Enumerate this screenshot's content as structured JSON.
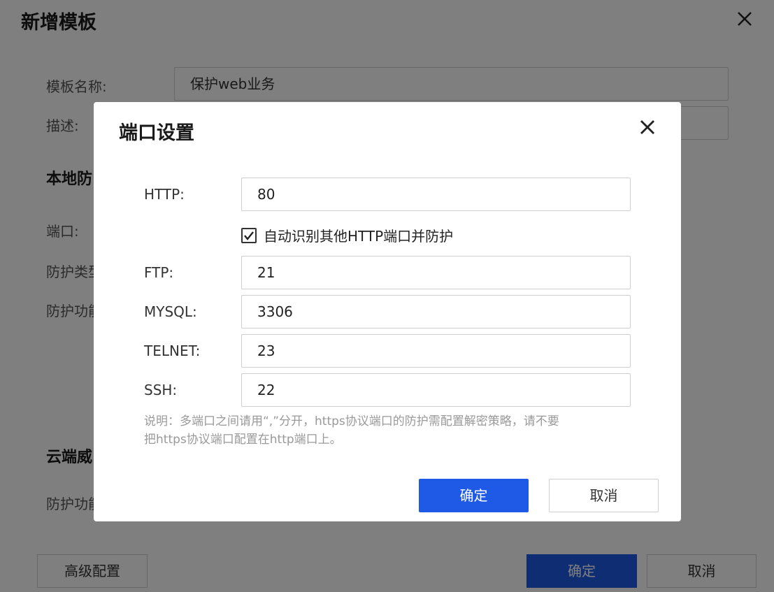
{
  "background": {
    "title": "新增模板",
    "template_name_label": "模板名称:",
    "template_name_value": "保护web业务",
    "description_label": "描述:",
    "local_section_heading": "本地防",
    "port_label": "端口:",
    "protect_type_label": "防护类型",
    "protect_func_label": "防护功能",
    "cloud_section_heading": "云端威",
    "cloud_protect_func_label": "防护功能",
    "advanced_button": "高级配置",
    "confirm_button": "确定",
    "cancel_button": "取消"
  },
  "modal": {
    "title": "端口设置",
    "fields": [
      {
        "label": "HTTP:",
        "value": "80"
      },
      {
        "label": "FTP:",
        "value": "21"
      },
      {
        "label": "MYSQL:",
        "value": "3306"
      },
      {
        "label": "TELNET:",
        "value": "23"
      },
      {
        "label": "SSH:",
        "value": "22"
      }
    ],
    "auto_detect": {
      "label": "自动识别其他HTTP端口并防护",
      "checked": true
    },
    "note_line1": "说明：多端口之间请用“,”分开，https协议端口的防护需配置解密策略，请不要",
    "note_line2": "把https协议端口配置在http端口上。",
    "confirm_button": "确定",
    "cancel_button": "取消"
  },
  "colors": {
    "primary": "#1e5ae6",
    "overlay": "rgba(0,0,0,0.5)",
    "note_text": "#999999"
  }
}
